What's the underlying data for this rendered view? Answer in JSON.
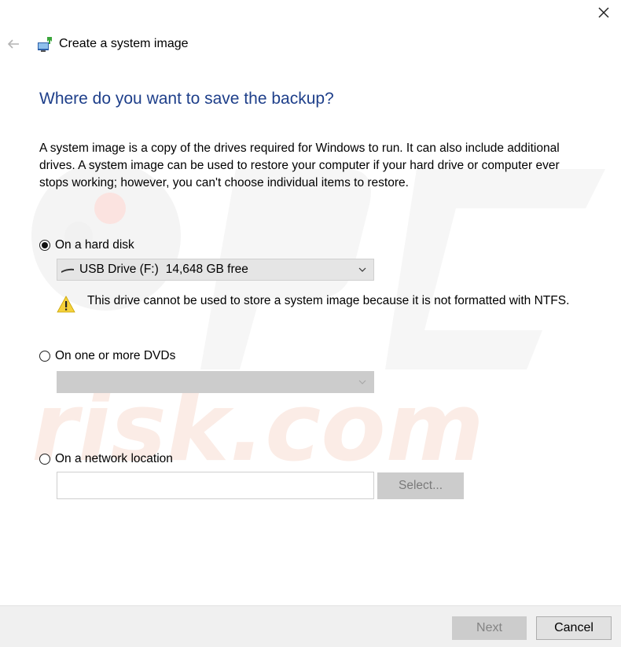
{
  "window": {
    "title": "Create a system image",
    "close_icon": "close-icon",
    "back_icon": "back-arrow-icon"
  },
  "heading": "Where do you want to save the backup?",
  "description": "A system image is a copy of the drives required for Windows to run. It can also include additional drives. A system image can be used to restore your computer if your hard drive or computer ever stops working; however, you can't choose individual items to restore.",
  "options": {
    "hard_disk": {
      "label": "On a hard disk",
      "selected": true,
      "drive_label": "USB Drive (F:)",
      "drive_free": "14,648 GB free",
      "warning": "This drive cannot be used to store a system image because it is not formatted with NTFS."
    },
    "dvd": {
      "label": "On one or more DVDs",
      "selected": false,
      "value": ""
    },
    "network": {
      "label": "On a network location",
      "selected": false,
      "value": "",
      "select_label": "Select..."
    }
  },
  "footer": {
    "next_label": "Next",
    "cancel_label": "Cancel"
  },
  "colors": {
    "heading": "#1e3f8a",
    "disabled_bg": "#cccccc",
    "footer_bg": "#f0f0f0"
  }
}
